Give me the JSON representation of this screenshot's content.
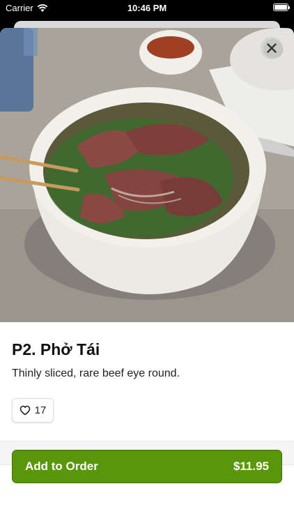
{
  "status_bar": {
    "carrier": "Carrier",
    "time": "10:46 PM"
  },
  "item": {
    "title": "P2. Phở Tái",
    "description": "Thinly sliced, rare beef eye round.",
    "likes": "17",
    "photo_subject": "bowl-of-pho-photo"
  },
  "order": {
    "label": "Add to Order",
    "price": "$11.95"
  },
  "colors": {
    "accent": "#5a960a",
    "accent_border": "#3f6d06",
    "sheet_bg": "#ffffff"
  },
  "icons": {
    "close": "close-icon",
    "like": "heart-icon",
    "wifi": "wifi-icon",
    "battery": "battery-icon"
  }
}
